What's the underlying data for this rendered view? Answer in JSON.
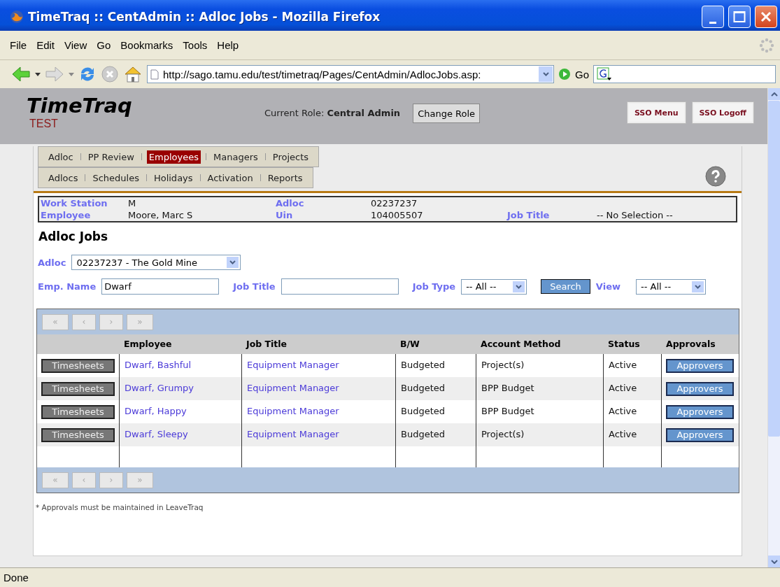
{
  "window": {
    "title": "TimeTraq :: CentAdmin :: Adloc Jobs - Mozilla Firefox"
  },
  "menu_bar": [
    "File",
    "Edit",
    "View",
    "Go",
    "Bookmarks",
    "Tools",
    "Help"
  ],
  "toolbar": {
    "url": "http://sago.tamu.edu/test/timetraq/Pages/CentAdmin/AdlocJobs.asp:",
    "go_label": "Go"
  },
  "header": {
    "logo": "TimeTraq",
    "environment": "TEST",
    "role_label": "Current Role:",
    "role": "Central Admin",
    "change_role": "Change Role",
    "sso_buttons": [
      "SSO Menu",
      "SSO Logoff"
    ]
  },
  "nav_primary": [
    {
      "label": "Adloc",
      "selected": false
    },
    {
      "label": "PP Review",
      "selected": false
    },
    {
      "label": "Employees",
      "selected": true
    },
    {
      "label": "Managers",
      "selected": false
    },
    {
      "label": "Projects",
      "selected": false
    }
  ],
  "nav_secondary": [
    {
      "label": "Adlocs",
      "selected": false
    },
    {
      "label": "Schedules",
      "selected": false
    },
    {
      "label": "Holidays",
      "selected": false
    },
    {
      "label": "Activation",
      "selected": false
    },
    {
      "label": "Reports",
      "selected": false
    }
  ],
  "info": [
    [
      {
        "label": "Work Station",
        "value": "M"
      },
      {
        "label": "Adloc",
        "value": "02237237"
      }
    ],
    [
      {
        "label": "Employee",
        "value": "Moore, Marc S"
      },
      {
        "label": "Uin",
        "value": "104005507"
      },
      {
        "label": "Job Title",
        "value": "-- No Selection --"
      }
    ]
  ],
  "page_title": "Adloc Jobs",
  "adloc_filter": {
    "label": "Adloc",
    "value": "02237237 - The Gold Mine"
  },
  "filters": {
    "emp_name_label": "Emp. Name",
    "emp_name_value": "Dwarf",
    "job_title_label": "Job Title",
    "job_type_label": "Job Type",
    "job_type_value": "-- All --",
    "search_button": "Search",
    "view_label": "View",
    "view_value": "-- All --"
  },
  "grid": {
    "pager_top": [
      {
        "label": "«",
        "disabled": true
      },
      {
        "label": "‹",
        "disabled": true
      },
      {
        "label": "›",
        "disabled": true
      },
      {
        "label": "»",
        "disabled": true
      }
    ],
    "columns": [
      "Employee",
      "Job Title",
      "B/W",
      "Account Method",
      "Status",
      "Approvals"
    ],
    "rows": [
      {
        "action": "Timesheets",
        "employee": "Dwarf, Bashful",
        "job_title": "Equipment Manager",
        "bw": "Budgeted",
        "account_method": "Project(s)",
        "status": "Active",
        "approvals": "Approvers"
      },
      {
        "action": "Timesheets",
        "employee": "Dwarf, Grumpy",
        "job_title": "Equipment Manager",
        "bw": "Budgeted",
        "account_method": "BPP Budget",
        "status": "Active",
        "approvals": "Approvers"
      },
      {
        "action": "Timesheets",
        "employee": "Dwarf, Happy",
        "job_title": "Equipment Manager",
        "bw": "Budgeted",
        "account_method": "BPP Budget",
        "status": "Active",
        "approvals": "Approvers"
      },
      {
        "action": "Timesheets",
        "employee": "Dwarf, Sleepy",
        "job_title": "Equipment Manager",
        "bw": "Budgeted",
        "account_method": "Project(s)",
        "status": "Active",
        "approvals": "Approvers"
      }
    ],
    "pager_bottom": [
      {
        "label": "«",
        "disabled": true
      },
      {
        "label": "‹",
        "disabled": true
      },
      {
        "label": "›",
        "disabled": true
      },
      {
        "label": "»",
        "disabled": true
      }
    ]
  },
  "footnote": "* Approvals must be maintained in LeaveTraq",
  "status_bar": "Done"
}
